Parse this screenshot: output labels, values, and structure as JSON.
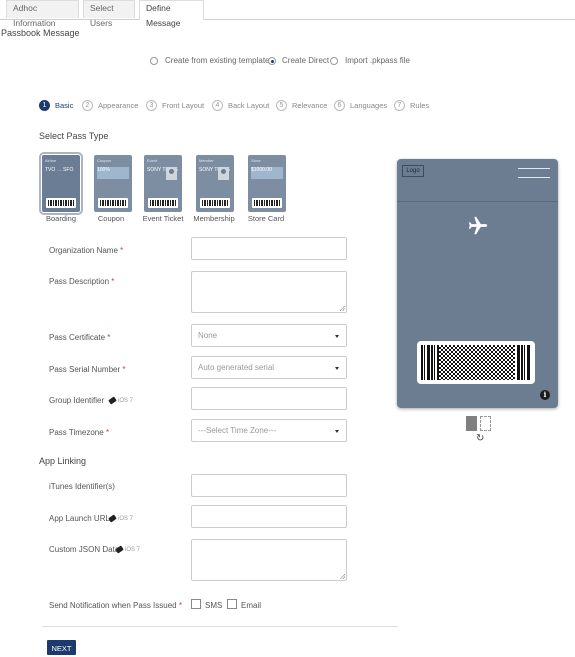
{
  "tabs": [
    {
      "label": "Adhoc Information"
    },
    {
      "label": "Select Users"
    },
    {
      "label": "Define Message"
    }
  ],
  "page_title": "Passbook Message",
  "creation_options": [
    {
      "label": "Create from existing template",
      "selected": false
    },
    {
      "label": "Create Direct",
      "selected": true
    },
    {
      "label": "Import .pkpass file",
      "selected": false
    }
  ],
  "steps": [
    {
      "num": "1",
      "label": "Basic"
    },
    {
      "num": "2",
      "label": "Appearance"
    },
    {
      "num": "3",
      "label": "Front Layout"
    },
    {
      "num": "4",
      "label": "Back Layout"
    },
    {
      "num": "5",
      "label": "Relevance"
    },
    {
      "num": "6",
      "label": "Languages"
    },
    {
      "num": "7",
      "label": "Rules"
    }
  ],
  "select_pass_type_title": "Select Pass Type",
  "pass_types": [
    {
      "label": "Boarding",
      "selected": true,
      "head": "Airline",
      "text": "TVO → SFO"
    },
    {
      "label": "Coupon",
      "selected": false,
      "head": "Coupon",
      "text": "100%"
    },
    {
      "label": "Event Ticket",
      "selected": false,
      "head": "Event",
      "text": "SONY THING"
    },
    {
      "label": "Membership",
      "selected": false,
      "head": "Member",
      "text": "SONY THING"
    },
    {
      "label": "Store Card",
      "selected": false,
      "head": "Store",
      "text": "$1000.00"
    }
  ],
  "fields": {
    "organization_name": {
      "label": "Organization Name",
      "value": ""
    },
    "pass_description": {
      "label": "Pass Description",
      "value": ""
    },
    "pass_certificate": {
      "label": "Pass Certificate",
      "value": "None"
    },
    "pass_serial_number": {
      "label": "Pass Serial Number",
      "value": "Auto generated serial"
    },
    "group_identifier": {
      "label": "Group Identifier",
      "ios": "iOS 7",
      "value": ""
    },
    "pass_timezone": {
      "label": "Pass Timezone",
      "value": "---Select Time Zone---"
    }
  },
  "required_mark": "*",
  "app_linking_title": "App Linking",
  "app_linking": {
    "itunes_identifier": {
      "label": "iTunes Identifier(s)",
      "value": ""
    },
    "app_launch_url": {
      "label": "App Launch URL",
      "ios": "iOS 7",
      "value": ""
    },
    "custom_json": {
      "label": "Custom JSON Data",
      "ios": "iOS 7",
      "value": ""
    }
  },
  "notification": {
    "label": "Send Notification when Pass Issued",
    "options": [
      {
        "label": "SMS",
        "checked": false
      },
      {
        "label": "Email",
        "checked": false
      }
    ]
  },
  "next_button": "NEXT",
  "preview": {
    "logo_text": "Logo",
    "icon": "airplane-icon",
    "info_icon": "i",
    "background_color": "#6c7d92"
  },
  "colors": {
    "accent": "#1d3a6e"
  }
}
